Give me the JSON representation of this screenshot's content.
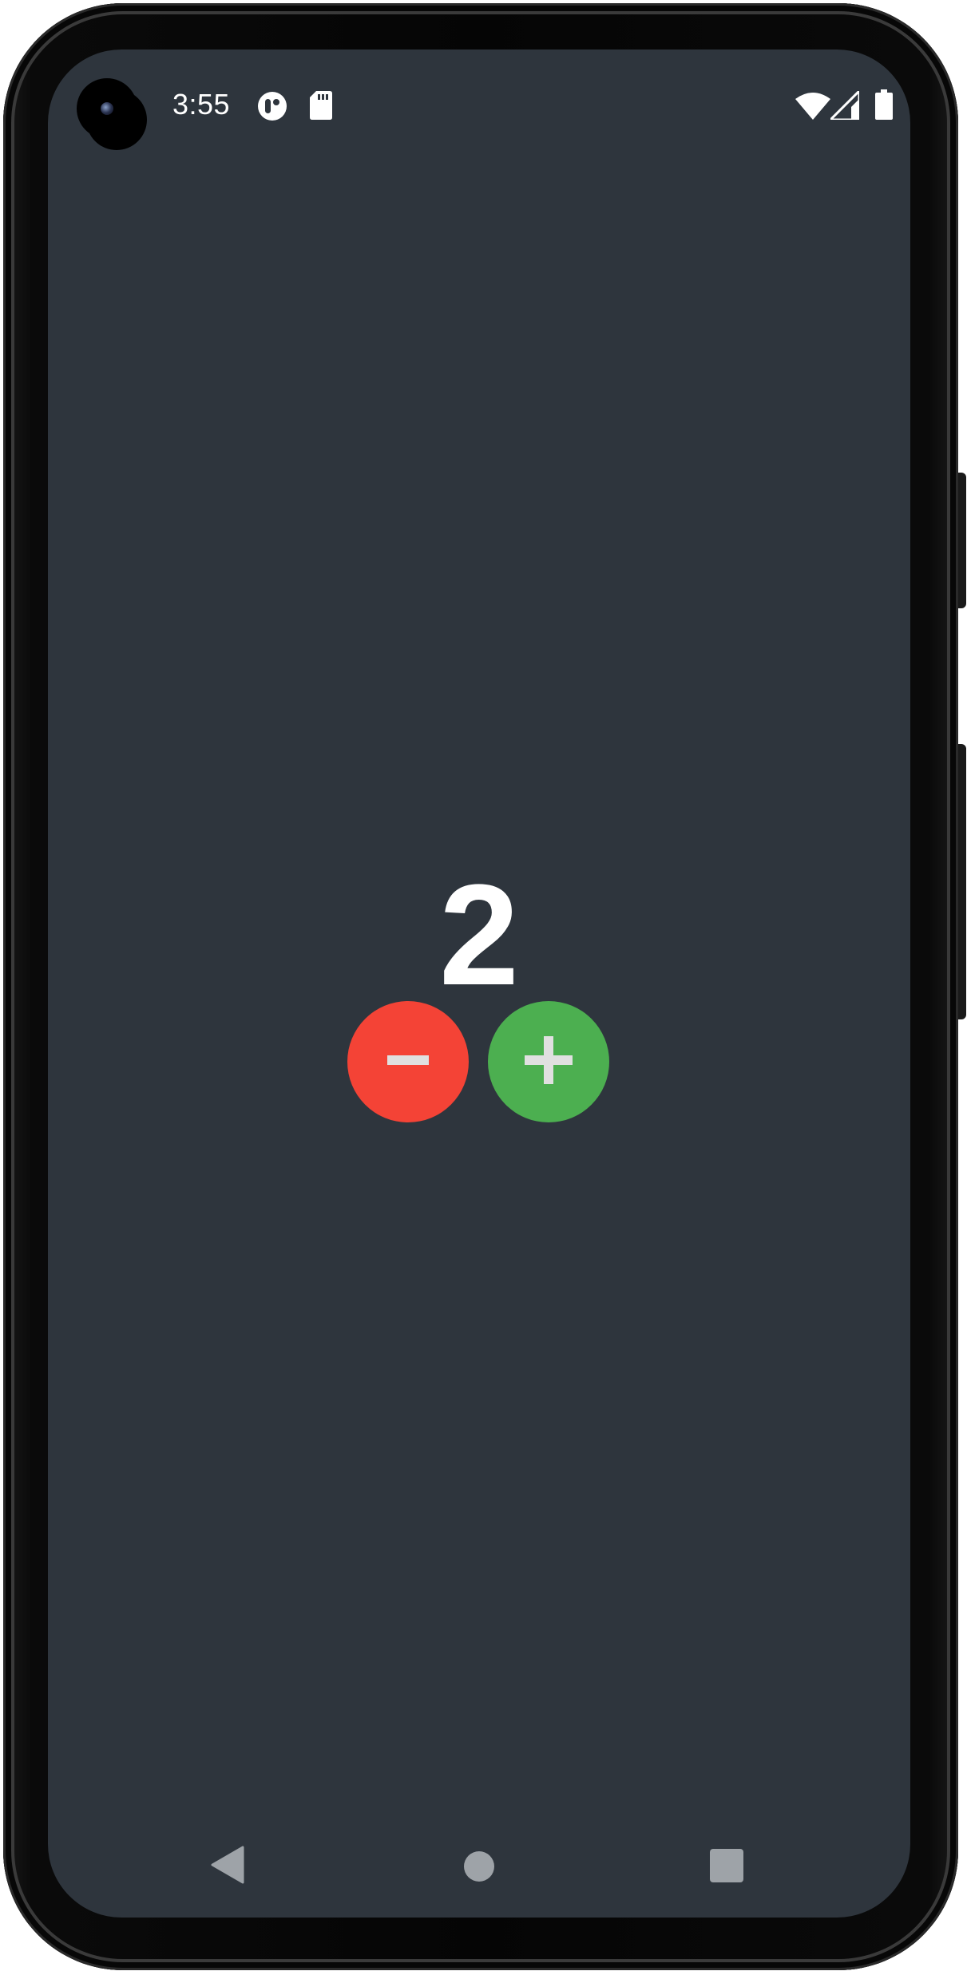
{
  "status_bar": {
    "time": "3:55",
    "icons": [
      "app-notification-icon",
      "sd-card-icon",
      "wifi-icon",
      "cellular-signal-icon",
      "battery-icon"
    ]
  },
  "counter": {
    "value": "2",
    "decrement_icon": "minus-icon",
    "increment_icon": "plus-icon"
  },
  "navigation": {
    "icons": [
      "back-icon",
      "home-icon",
      "recents-icon"
    ]
  },
  "colors": {
    "background": "#2e353d",
    "decrement": "#f44336",
    "increment": "#4caf50",
    "icon_light": "#e0e0e0",
    "nav_icon": "#9ea3a8"
  }
}
